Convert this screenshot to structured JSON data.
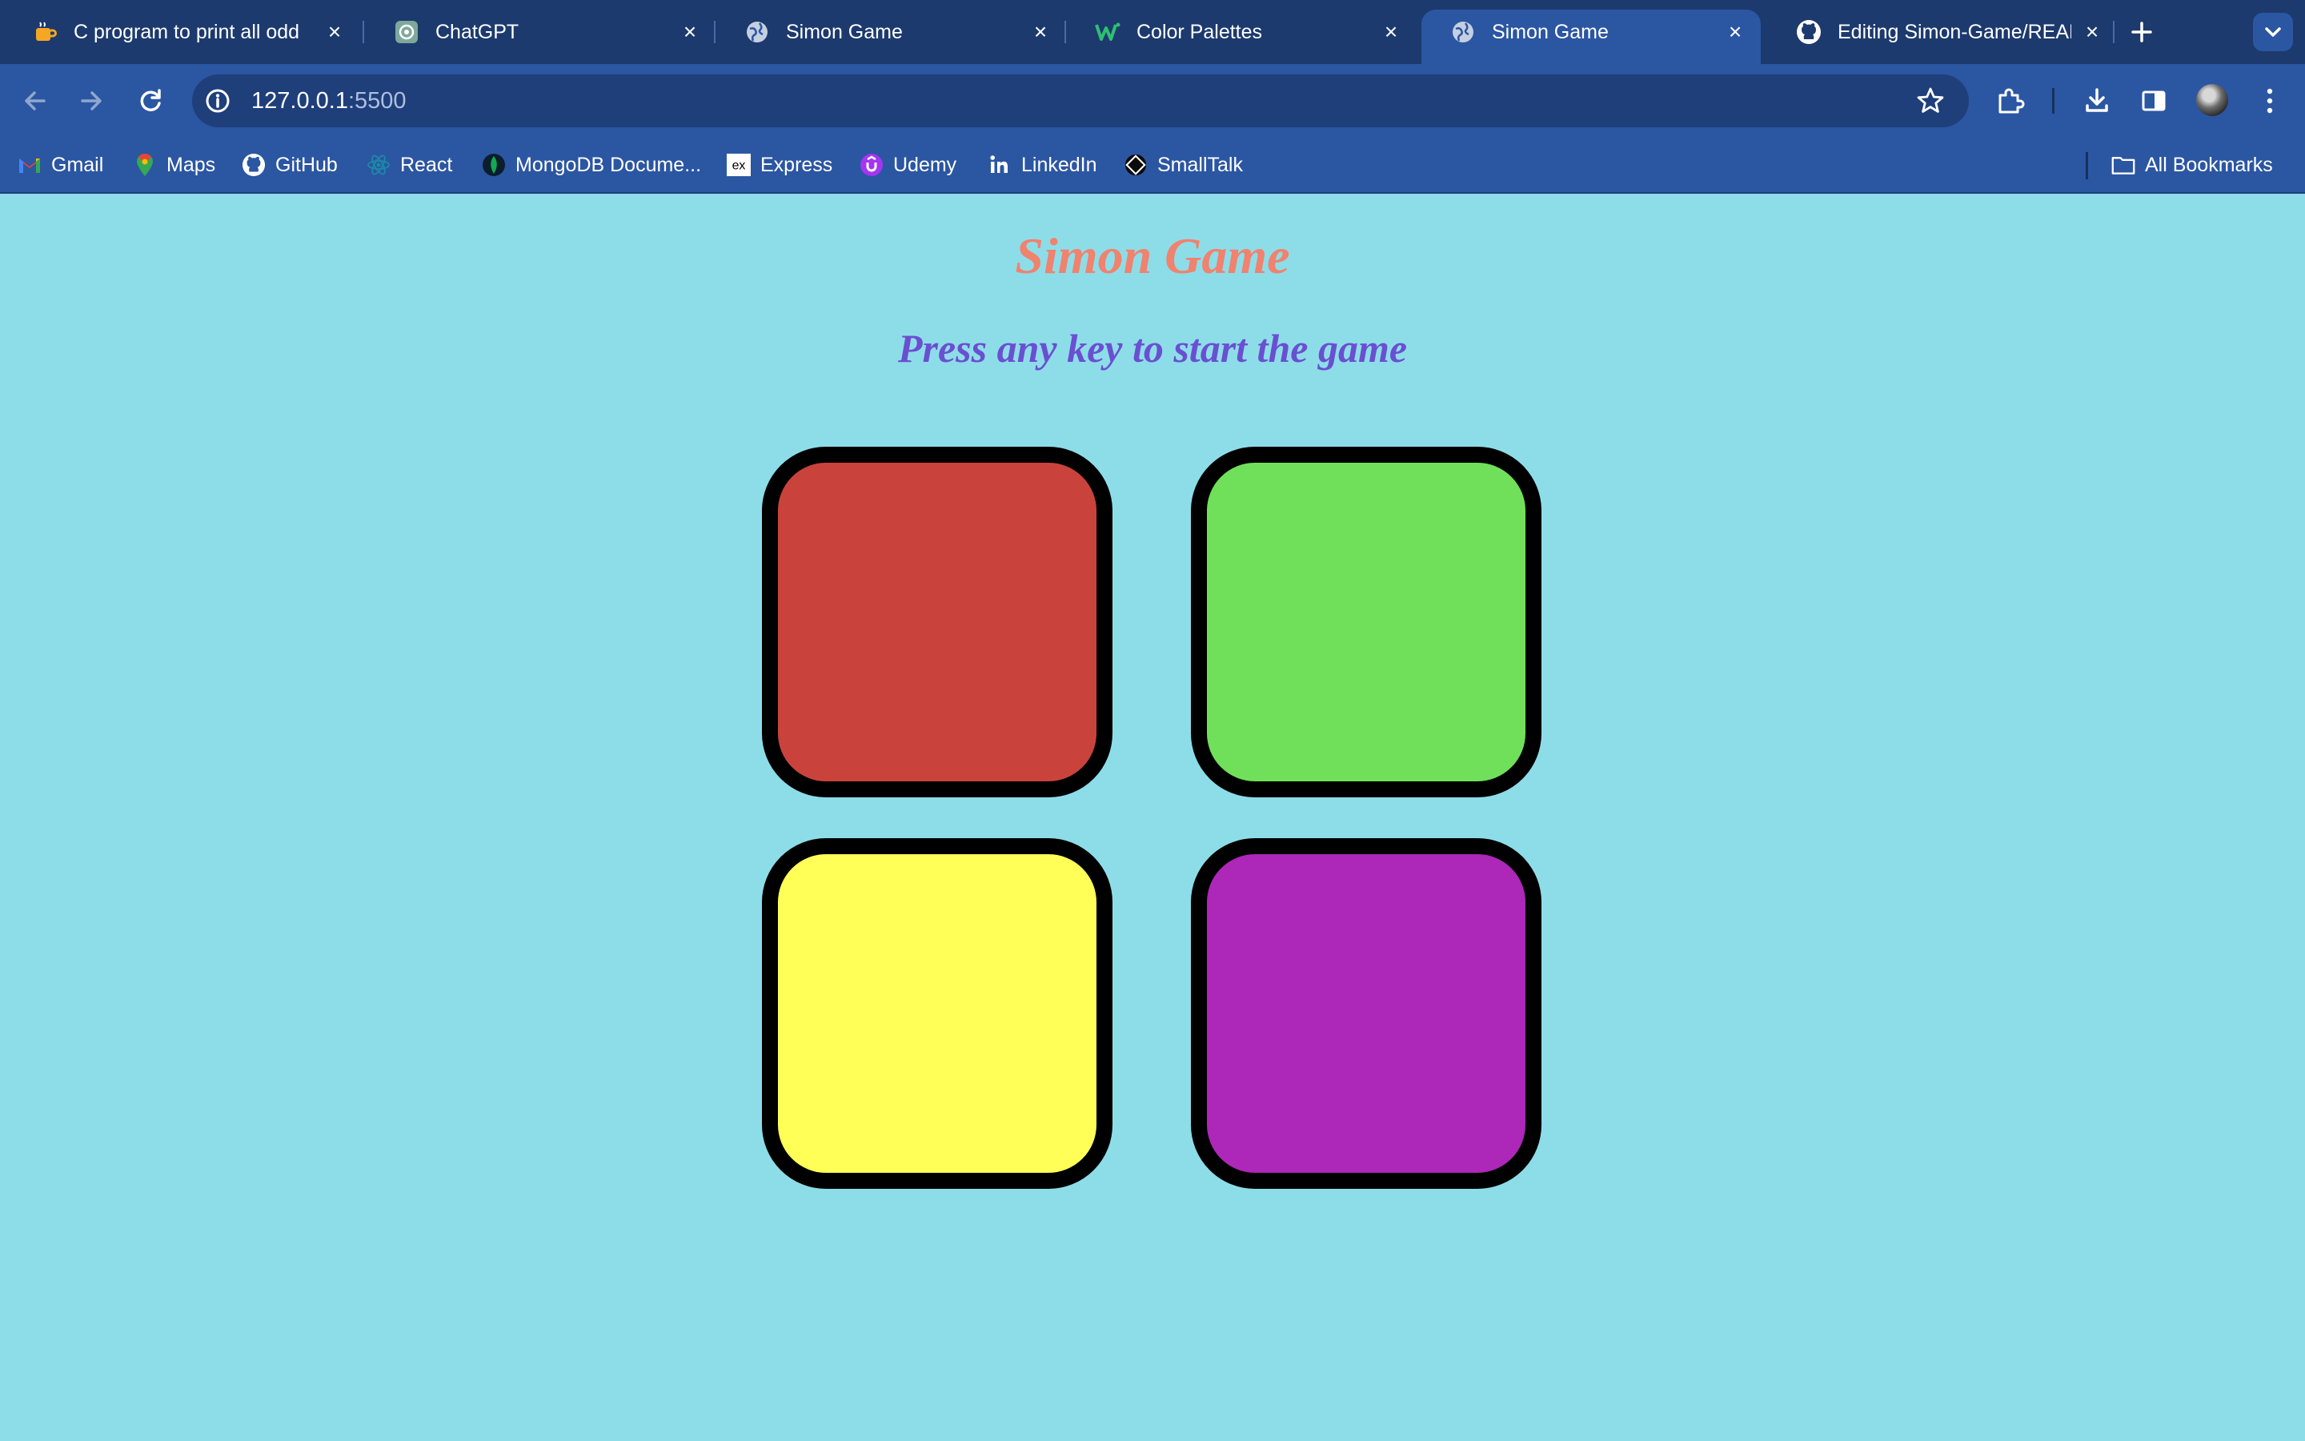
{
  "browser": {
    "tabs": [
      {
        "title": "C program to print all odd",
        "favicon": "coffee-cup-icon",
        "active": false
      },
      {
        "title": "ChatGPT",
        "favicon": "chatgpt-icon",
        "active": false
      },
      {
        "title": "Simon Game",
        "favicon": "globe-icon",
        "active": false
      },
      {
        "title": "Color Palettes",
        "favicon": "w-logo-icon",
        "active": false
      },
      {
        "title": "Simon Game",
        "favicon": "globe-icon",
        "active": true
      },
      {
        "title": "Editing Simon-Game/READ",
        "favicon": "github-icon",
        "active": false
      }
    ],
    "address": {
      "host": "127.0.0.1",
      "port": ":5500"
    },
    "bookmarks": [
      {
        "label": "Gmail",
        "icon": "gmail-icon"
      },
      {
        "label": "Maps",
        "icon": "maps-icon"
      },
      {
        "label": "GitHub",
        "icon": "github-icon"
      },
      {
        "label": "React",
        "icon": "react-icon"
      },
      {
        "label": "MongoDB Docume...",
        "icon": "mongodb-icon"
      },
      {
        "label": "Express",
        "icon": "express-icon"
      },
      {
        "label": "Udemy",
        "icon": "udemy-icon"
      },
      {
        "label": "LinkedIn",
        "icon": "linkedin-icon"
      },
      {
        "label": "SmallTalk",
        "icon": "smalltalk-icon"
      }
    ],
    "all_bookmarks_label": "All Bookmarks",
    "colors": {
      "tabstrip": "#1c3a6e",
      "toolbar": "#2b56a2"
    }
  },
  "page": {
    "title": "Simon Game",
    "subtitle": "Press any key to start the game",
    "background": "#8ddde9",
    "pads": [
      {
        "name": "red-pad",
        "color": "#c9433c"
      },
      {
        "name": "green-pad",
        "color": "#70e05a"
      },
      {
        "name": "yellow-pad",
        "color": "#ffff58"
      },
      {
        "name": "purple-pad",
        "color": "#ad27b8"
      }
    ]
  }
}
